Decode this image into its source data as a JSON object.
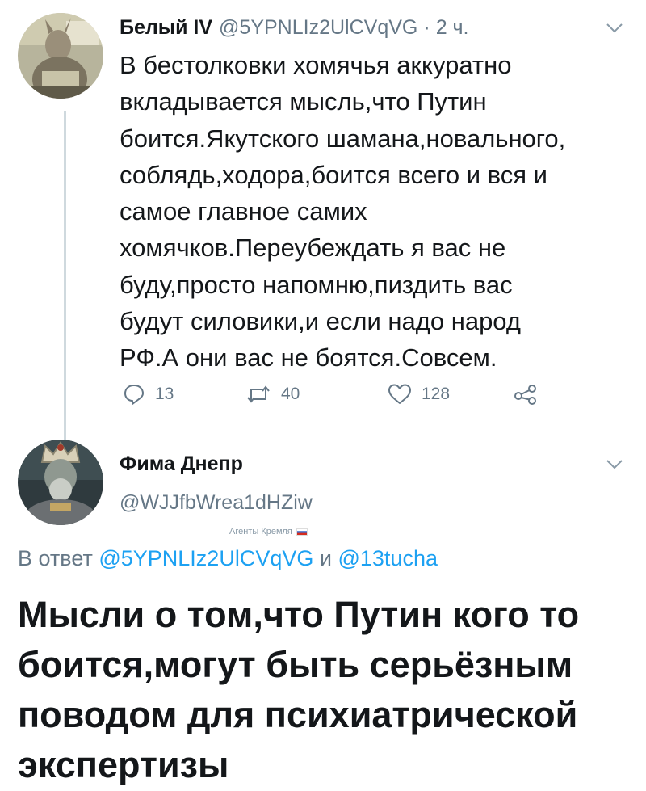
{
  "tweet1": {
    "name": "Белый IV",
    "handle": "@5YPNLIz2UlCVqVG",
    "separator": "·",
    "time": "2 ч.",
    "text_lines": [
      "В бестолковки хомячья аккуратно",
      "вкладывается мысль,что Путин",
      "боится.Якутского шамана,новального,",
      "соблядь,ходора,боится всего и вся и",
      "самое главное самих",
      "хомячков.Переубеждать я вас не",
      "буду,просто напомню,пиздить вас",
      "будут силовики,и если надо народ",
      "РФ.А они вас не боятся.Совсем."
    ],
    "replies": "13",
    "retweets": "40",
    "likes": "128"
  },
  "tweet2": {
    "name": "Фима Днепр",
    "handle": "@WJJfbWrea1dHZiw",
    "badge": "Агенты Кремля",
    "reply_prefix": "В ответ",
    "reply_mention1": "@5YPNLIz2UlCVqVG",
    "reply_and": "и",
    "reply_mention2": "@13tucha",
    "text_lines": [
      "Мысли о том,что Путин кого то",
      "боится,могут быть серьёзным",
      "поводом для психиатрической",
      "экспертизы"
    ]
  },
  "icons": {
    "reply": "reply-icon",
    "retweet": "retweet-icon",
    "like": "heart-icon",
    "share": "share-icon",
    "menu": "chevron-down-icon"
  },
  "colors": {
    "text": "#14171a",
    "secondary": "#657786",
    "link": "#1da1f2",
    "thread_line": "#cfd9de"
  }
}
